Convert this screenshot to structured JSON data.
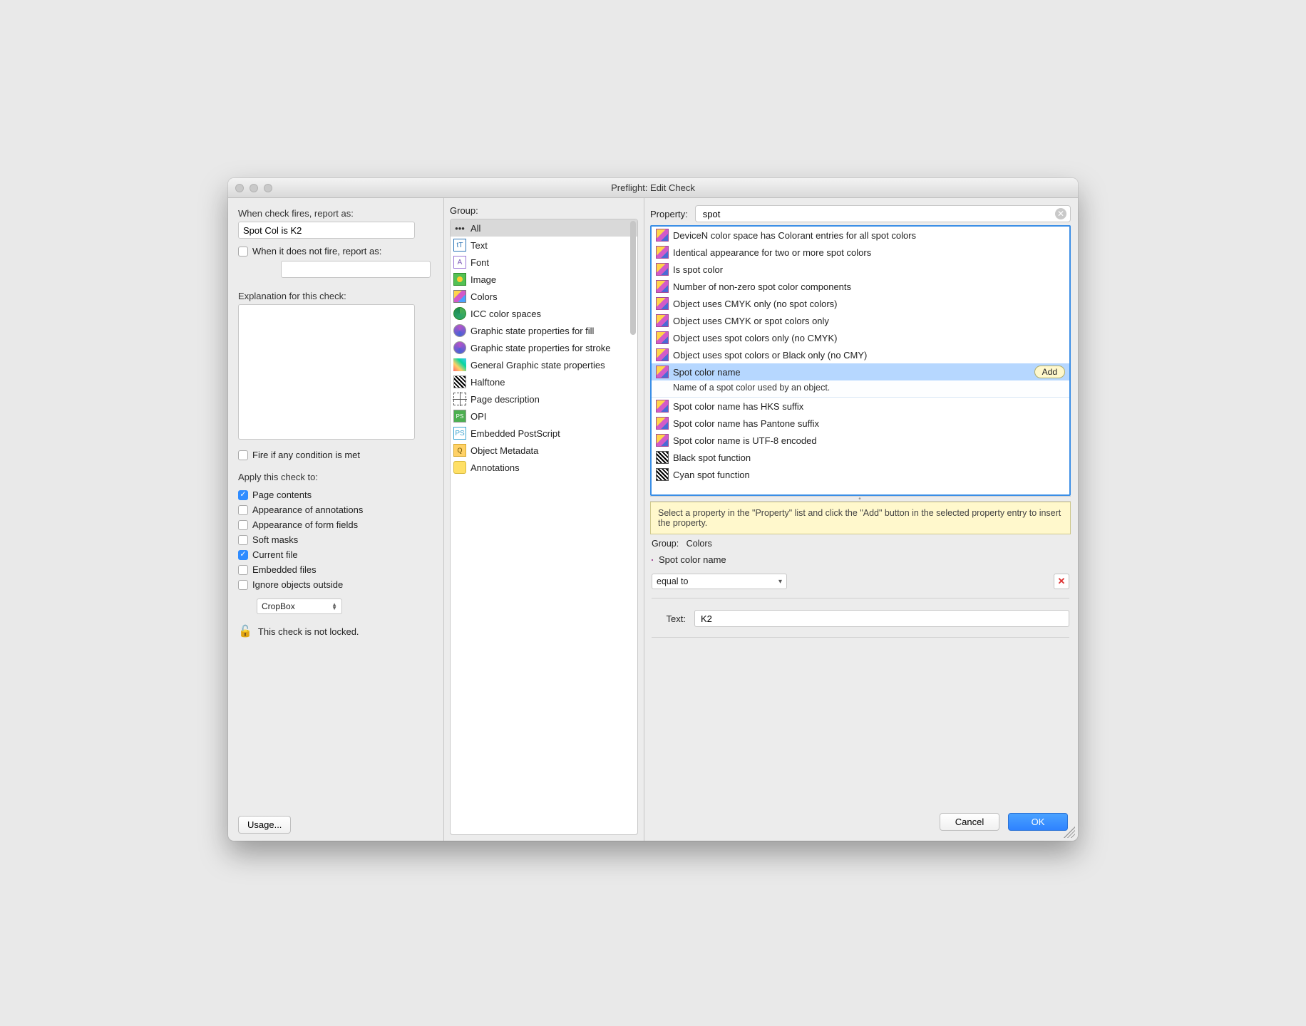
{
  "window": {
    "title": "Preflight: Edit Check"
  },
  "left": {
    "report_label": "When check fires, report as:",
    "report_value": "Spot Col is K2",
    "notfire_label": "When it does not fire, report as:",
    "notfire_value": "",
    "explanation_label": "Explanation for this check:",
    "explanation_value": "",
    "fire_any_label": "Fire if any condition is met",
    "apply_label": "Apply this check to:",
    "apply_items": [
      {
        "label": "Page contents",
        "checked": true
      },
      {
        "label": "Appearance of annotations",
        "checked": false
      },
      {
        "label": "Appearance of form fields",
        "checked": false
      },
      {
        "label": "Soft masks",
        "checked": false
      },
      {
        "label": "Current file",
        "checked": true
      },
      {
        "label": "Embedded files",
        "checked": false
      },
      {
        "label": "Ignore objects outside",
        "checked": false
      }
    ],
    "cropbox_label": "CropBox",
    "lock_label": "This check is not locked.",
    "usage_button": "Usage..."
  },
  "group": {
    "header": "Group:",
    "items": [
      {
        "label": "All",
        "icon": "none",
        "glyph": "•••",
        "selected": true
      },
      {
        "label": "Text",
        "icon": "text",
        "glyph": "tT"
      },
      {
        "label": "Font",
        "icon": "font",
        "glyph": "A"
      },
      {
        "label": "Image",
        "icon": "img",
        "glyph": ""
      },
      {
        "label": "Colors",
        "icon": "colors",
        "glyph": ""
      },
      {
        "label": "ICC color spaces",
        "icon": "icc",
        "glyph": ""
      },
      {
        "label": "Graphic state properties for fill",
        "icon": "gstate",
        "glyph": ""
      },
      {
        "label": "Graphic state properties for stroke",
        "icon": "gstate",
        "glyph": ""
      },
      {
        "label": "General Graphic state properties",
        "icon": "general",
        "glyph": ""
      },
      {
        "label": "Halftone",
        "icon": "halftone",
        "glyph": ""
      },
      {
        "label": "Page description",
        "icon": "pagedesc",
        "glyph": ""
      },
      {
        "label": "OPI",
        "icon": "opi",
        "glyph": "PS"
      },
      {
        "label": "Embedded PostScript",
        "icon": "eps",
        "glyph": "PS"
      },
      {
        "label": "Object Metadata",
        "icon": "meta",
        "glyph": ""
      },
      {
        "label": "Annotations",
        "icon": "annot",
        "glyph": ""
      }
    ]
  },
  "property": {
    "header": "Property:",
    "search_value": "spot",
    "items": [
      {
        "label": "DeviceN color space has Colorant entries for all spot colors",
        "icon": "house"
      },
      {
        "label": "Identical appearance for two or more spot colors",
        "icon": "house"
      },
      {
        "label": "Is spot color",
        "icon": "house"
      },
      {
        "label": "Number of non-zero spot color components",
        "icon": "house"
      },
      {
        "label": "Object uses CMYK only (no spot colors)",
        "icon": "house"
      },
      {
        "label": "Object uses CMYK or spot colors only",
        "icon": "house"
      },
      {
        "label": "Object uses spot colors only (no CMYK)",
        "icon": "house"
      },
      {
        "label": "Object uses spot colors or Black only (no CMY)",
        "icon": "house"
      },
      {
        "label": "Spot color name",
        "icon": "house",
        "selected": true,
        "add_label": "Add",
        "description": "Name of a spot color used by an object."
      },
      {
        "label": "Spot color name has HKS suffix",
        "icon": "house"
      },
      {
        "label": "Spot color name has Pantone suffix",
        "icon": "house"
      },
      {
        "label": "Spot color name is UTF-8 encoded",
        "icon": "house"
      },
      {
        "label": "Black spot function",
        "icon": "halftone"
      },
      {
        "label": "Cyan spot function",
        "icon": "halftone"
      }
    ]
  },
  "hint": "Select a property in the \"Property\" list and click the \"Add\" button in the selected property entry to insert the property.",
  "condition": {
    "group_prefix": "Group:",
    "group_value": "Colors",
    "name": "Spot color name",
    "operator": "equal to",
    "text_label": "Text:",
    "text_value": "K2"
  },
  "footer": {
    "cancel": "Cancel",
    "ok": "OK"
  }
}
